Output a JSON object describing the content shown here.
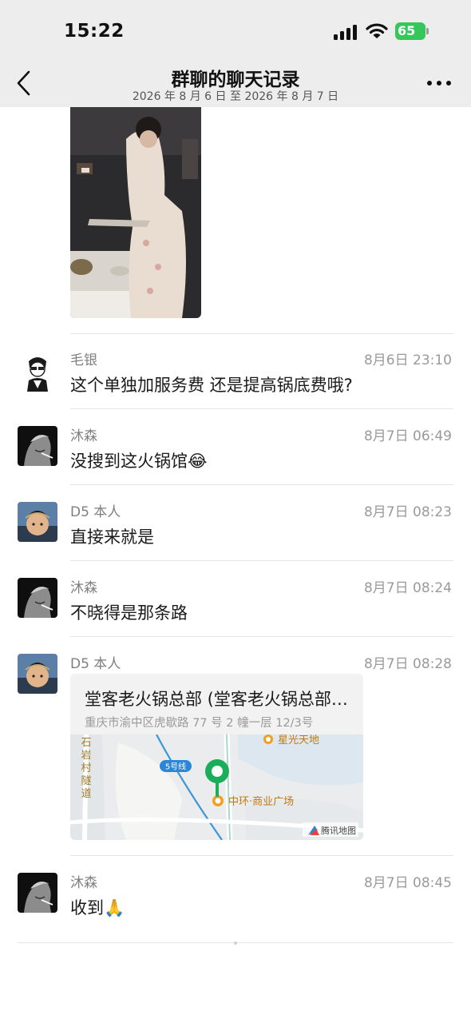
{
  "status_bar": {
    "time": "15:22",
    "battery": "65"
  },
  "header": {
    "title": "群聊的聊天记录",
    "subtitle": "2026 年 8 月 6 日 至 2026 年 8 月 7 日"
  },
  "messages": [
    {
      "sender": "毛银",
      "time": "8月6日 23:10",
      "text": "这个单独加服务费 还是提高锅底费哦?"
    },
    {
      "sender": "沐森",
      "time": "8月7日 06:49",
      "text": "没搜到这火锅馆"
    },
    {
      "sender": "D5 本人",
      "time": "8月7日 08:23",
      "text": "直接来就是"
    },
    {
      "sender": "沐森",
      "time": "8月7日 08:24",
      "text": "不晓得是那条路"
    },
    {
      "sender": "D5 本人",
      "time": "8月7日 08:28"
    },
    {
      "sender": "沐森",
      "time": "8月7日 08:45",
      "text": "收到"
    }
  ],
  "location": {
    "name": "堂客老火锅总部 (堂客老火锅总部店)",
    "address": "重庆市渝中区虎歇路 77 号 2 幢一层 12/3号",
    "map_labels": {
      "poi_top": "星光天地",
      "tunnel": "石岩村隧道",
      "metro": "5号线",
      "poi_main": "中环·商业广场",
      "watermark": "腾讯地图"
    }
  },
  "emoji": {
    "laugh_cry": "😂",
    "praying": "🙏"
  },
  "colors": {
    "header_bg": "#ededed",
    "battery": "#35c759",
    "pin": "#1aad5a",
    "metro": "#2a86d6"
  }
}
